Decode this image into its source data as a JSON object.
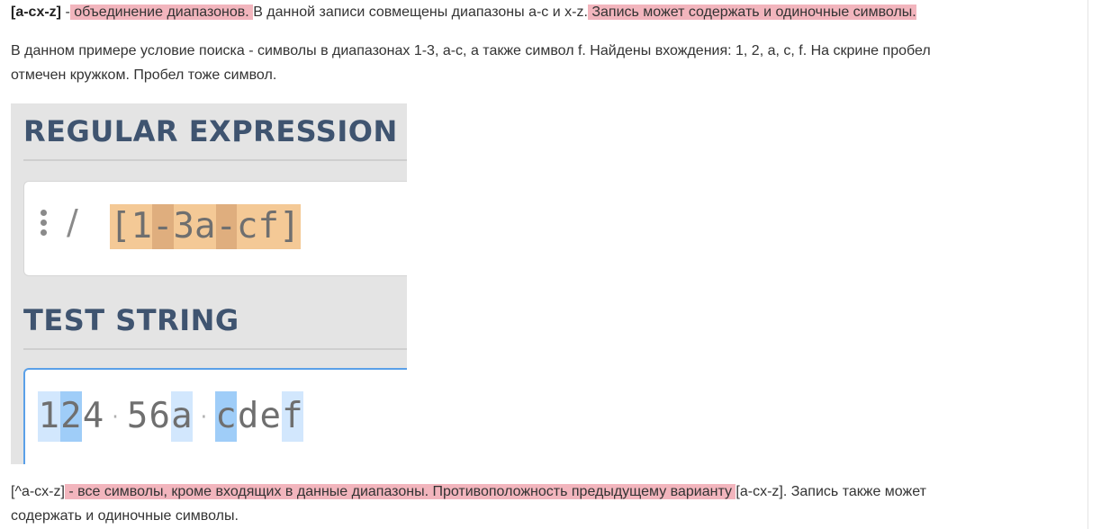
{
  "paragraph1": {
    "term": "[a-cx-z]",
    "dash": " -",
    "hl1": " объединение диапазонов. ",
    "plain": "В данной записи совмещены диапазоны a-c и x-z.",
    "hl2": " Запись может содержать и одиночные символы. "
  },
  "paragraph2": {
    "line1": "В данном примере условие поиска - символы в диапазонах 1-3, a-c, а также символ f. Найдены вхождения: 1, 2, a, c, f. На скрине пробел",
    "line2": "отмечен кружком. Пробел тоже символ."
  },
  "screenshot": {
    "regex_heading": "REGULAR EXPRESSION",
    "delimiter": "/",
    "regex_chars": [
      "[",
      "1",
      "-",
      "3",
      "a",
      "-",
      "c",
      "f",
      "]"
    ],
    "test_heading": "TEST STRING",
    "test_chars": [
      "1",
      "2",
      "4",
      "·",
      "5",
      "6",
      "a",
      "·",
      "c",
      "d",
      "e",
      "f"
    ]
  },
  "paragraph3": {
    "term": "[^a-cx-z]",
    "hl1": " - все символы, кроме входящих в данные диапазоны. Противоположность предыдущему варианту ",
    "rest": "[a-cx-z]. Запись также может",
    "line2": "содержать и одиночные символы."
  },
  "colors": {
    "highlight": "#f2b5bd",
    "group_fill": "#f4c996",
    "group_dark": "#dfae7e",
    "match_light": "#d2e7fd",
    "match_dark": "#9fcdf8",
    "heading": "#3f5470"
  }
}
